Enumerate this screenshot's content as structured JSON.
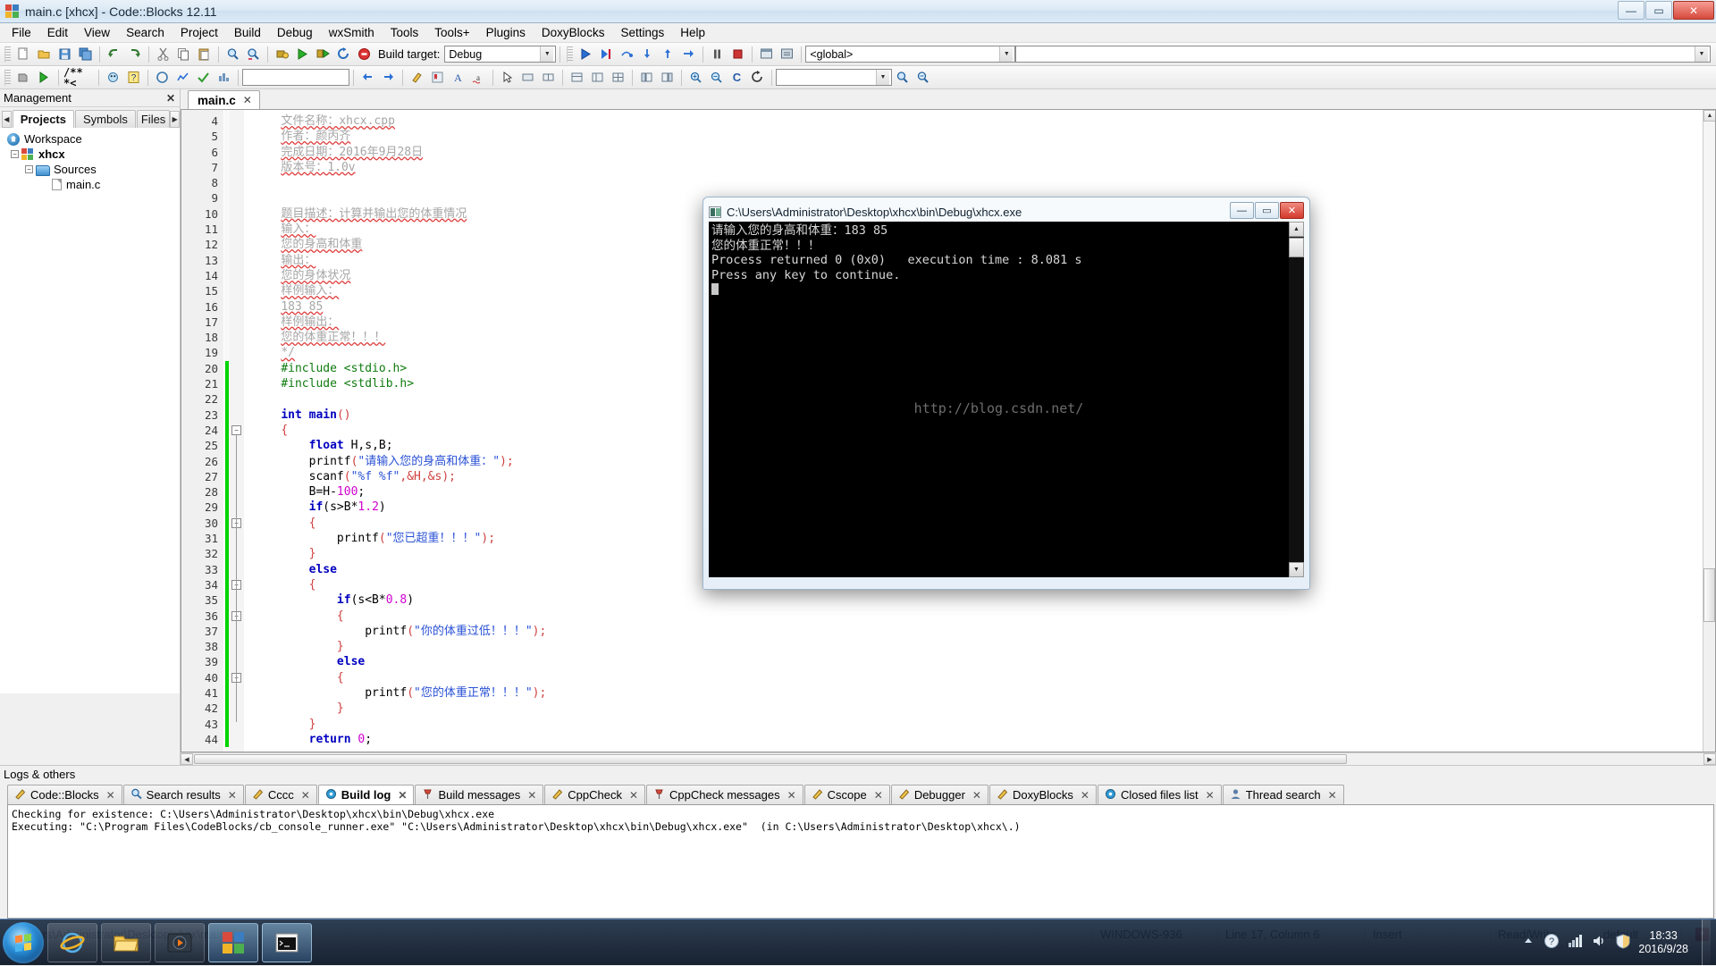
{
  "window": {
    "title": "main.c [xhcx] - Code::Blocks 12.11",
    "buttons": {
      "minimize": "—",
      "maximize": "▭",
      "close": "✕"
    }
  },
  "menubar": {
    "items": [
      "File",
      "Edit",
      "View",
      "Search",
      "Project",
      "Build",
      "Debug",
      "wxSmith",
      "Tools",
      "Tools+",
      "Plugins",
      "DoxyBlocks",
      "Settings",
      "Help"
    ]
  },
  "toolbar": {
    "build_target_label": "Build target:",
    "build_target_value": "Debug",
    "scope_value": "<global>",
    "symbol_value": "",
    "search_value": "",
    "docblock_label": "/** *<"
  },
  "management": {
    "header": "Management",
    "close_label": "✕",
    "tabs": [
      {
        "label": "Projects",
        "active": true
      },
      {
        "label": "Symbols",
        "active": false
      },
      {
        "label": "Files",
        "active": false
      }
    ],
    "tree": {
      "workspace": "Workspace",
      "project": "xhcx",
      "group": "Sources",
      "file": "main.c"
    }
  },
  "editor": {
    "tabs": [
      {
        "label": "main.c",
        "close": "✕",
        "active": true
      }
    ],
    "first_line_number": 4,
    "lines": [
      {
        "n": 4,
        "segments": [
          {
            "t": "    ",
            "c": ""
          },
          {
            "t": "文件名称：xhcx.cpp",
            "c": "cmt"
          }
        ]
      },
      {
        "n": 5,
        "segments": [
          {
            "t": "    ",
            "c": ""
          },
          {
            "t": "作者：颜丙齐",
            "c": "cmt"
          }
        ]
      },
      {
        "n": 6,
        "segments": [
          {
            "t": "    ",
            "c": ""
          },
          {
            "t": "完成日期：2016年9月28日",
            "c": "cmt"
          }
        ]
      },
      {
        "n": 7,
        "segments": [
          {
            "t": "    ",
            "c": ""
          },
          {
            "t": "版本号：1.0v",
            "c": "cmt"
          }
        ]
      },
      {
        "n": 8,
        "segments": []
      },
      {
        "n": 9,
        "segments": []
      },
      {
        "n": 10,
        "segments": [
          {
            "t": "    ",
            "c": ""
          },
          {
            "t": "题目描述：计算并输出您的体重情况",
            "c": "cmt"
          }
        ]
      },
      {
        "n": 11,
        "segments": [
          {
            "t": "    ",
            "c": ""
          },
          {
            "t": "输入：",
            "c": "cmt"
          }
        ]
      },
      {
        "n": 12,
        "segments": [
          {
            "t": "    ",
            "c": ""
          },
          {
            "t": "您的身高和体重",
            "c": "cmt"
          }
        ]
      },
      {
        "n": 13,
        "segments": [
          {
            "t": "    ",
            "c": ""
          },
          {
            "t": "输出：",
            "c": "cmt"
          }
        ]
      },
      {
        "n": 14,
        "segments": [
          {
            "t": "    ",
            "c": ""
          },
          {
            "t": "您的身体状况",
            "c": "cmt"
          }
        ]
      },
      {
        "n": 15,
        "segments": [
          {
            "t": "    ",
            "c": ""
          },
          {
            "t": "样例输入：",
            "c": "cmt"
          }
        ]
      },
      {
        "n": 16,
        "segments": [
          {
            "t": "    ",
            "c": ""
          },
          {
            "t": "183 85",
            "c": "cmt"
          }
        ]
      },
      {
        "n": 17,
        "segments": [
          {
            "t": "    ",
            "c": ""
          },
          {
            "t": "样例输出：",
            "c": "cmt"
          }
        ]
      },
      {
        "n": 18,
        "segments": [
          {
            "t": "    ",
            "c": ""
          },
          {
            "t": "您的体重正常！！！",
            "c": "cmt"
          }
        ]
      },
      {
        "n": 19,
        "segments": [
          {
            "t": "    ",
            "c": ""
          },
          {
            "t": "*/",
            "c": "cmt"
          }
        ]
      },
      {
        "n": 20,
        "segments": [
          {
            "t": "    ",
            "c": ""
          },
          {
            "t": "#include <stdio.h>",
            "c": "pre"
          }
        ]
      },
      {
        "n": 21,
        "segments": [
          {
            "t": "    ",
            "c": ""
          },
          {
            "t": "#include <stdlib.h>",
            "c": "pre"
          }
        ]
      },
      {
        "n": 22,
        "segments": []
      },
      {
        "n": 23,
        "segments": [
          {
            "t": "    ",
            "c": ""
          },
          {
            "t": "int main",
            "c": "kw"
          },
          {
            "t": "()",
            "c": "op"
          }
        ]
      },
      {
        "n": 24,
        "segments": [
          {
            "t": "    ",
            "c": ""
          },
          {
            "t": "{",
            "c": "brace"
          }
        ]
      },
      {
        "n": 25,
        "segments": [
          {
            "t": "        ",
            "c": ""
          },
          {
            "t": "float",
            "c": "kw"
          },
          {
            "t": " H,s,B;",
            "c": ""
          }
        ]
      },
      {
        "n": 26,
        "segments": [
          {
            "t": "        printf",
            "c": ""
          },
          {
            "t": "(",
            "c": "op"
          },
          {
            "t": "\"请输入您的身高和体重：\"",
            "c": "str"
          },
          {
            "t": ");",
            "c": "op"
          }
        ]
      },
      {
        "n": 27,
        "segments": [
          {
            "t": "        scanf",
            "c": ""
          },
          {
            "t": "(",
            "c": "op"
          },
          {
            "t": "\"%f %f\"",
            "c": "str"
          },
          {
            "t": ",&H,&s);",
            "c": "op"
          }
        ]
      },
      {
        "n": 28,
        "segments": [
          {
            "t": "        B=H-",
            "c": ""
          },
          {
            "t": "100",
            "c": "num"
          },
          {
            "t": ";",
            "c": ""
          }
        ]
      },
      {
        "n": 29,
        "segments": [
          {
            "t": "        ",
            "c": ""
          },
          {
            "t": "if",
            "c": "kw"
          },
          {
            "t": "(s>B*",
            "c": ""
          },
          {
            "t": "1.2",
            "c": "num"
          },
          {
            "t": ")",
            "c": ""
          }
        ]
      },
      {
        "n": 30,
        "segments": [
          {
            "t": "        ",
            "c": ""
          },
          {
            "t": "{",
            "c": "brace"
          }
        ]
      },
      {
        "n": 31,
        "segments": [
          {
            "t": "            printf",
            "c": ""
          },
          {
            "t": "(",
            "c": "op"
          },
          {
            "t": "\"您已超重！！！\"",
            "c": "str"
          },
          {
            "t": ");",
            "c": "op"
          }
        ]
      },
      {
        "n": 32,
        "segments": [
          {
            "t": "        ",
            "c": ""
          },
          {
            "t": "}",
            "c": "brace"
          }
        ]
      },
      {
        "n": 33,
        "segments": [
          {
            "t": "        ",
            "c": ""
          },
          {
            "t": "else",
            "c": "kw"
          }
        ]
      },
      {
        "n": 34,
        "segments": [
          {
            "t": "        ",
            "c": ""
          },
          {
            "t": "{",
            "c": "brace"
          }
        ]
      },
      {
        "n": 35,
        "segments": [
          {
            "t": "            ",
            "c": ""
          },
          {
            "t": "if",
            "c": "kw"
          },
          {
            "t": "(s<B*",
            "c": ""
          },
          {
            "t": "0.8",
            "c": "num"
          },
          {
            "t": ")",
            "c": ""
          }
        ]
      },
      {
        "n": 36,
        "segments": [
          {
            "t": "            ",
            "c": ""
          },
          {
            "t": "{",
            "c": "brace"
          }
        ]
      },
      {
        "n": 37,
        "segments": [
          {
            "t": "                printf",
            "c": ""
          },
          {
            "t": "(",
            "c": "op"
          },
          {
            "t": "\"你的体重过低！！！\"",
            "c": "str"
          },
          {
            "t": ");",
            "c": "op"
          }
        ]
      },
      {
        "n": 38,
        "segments": [
          {
            "t": "            ",
            "c": ""
          },
          {
            "t": "}",
            "c": "brace"
          }
        ]
      },
      {
        "n": 39,
        "segments": [
          {
            "t": "            ",
            "c": ""
          },
          {
            "t": "else",
            "c": "kw"
          }
        ]
      },
      {
        "n": 40,
        "segments": [
          {
            "t": "            ",
            "c": ""
          },
          {
            "t": "{",
            "c": "brace"
          }
        ]
      },
      {
        "n": 41,
        "segments": [
          {
            "t": "                printf",
            "c": ""
          },
          {
            "t": "(",
            "c": "op"
          },
          {
            "t": "\"您的体重正常！！！\"",
            "c": "str"
          },
          {
            "t": ");",
            "c": "op"
          }
        ]
      },
      {
        "n": 42,
        "segments": [
          {
            "t": "            ",
            "c": ""
          },
          {
            "t": "}",
            "c": "brace"
          }
        ]
      },
      {
        "n": 43,
        "segments": [
          {
            "t": "        ",
            "c": ""
          },
          {
            "t": "}",
            "c": "brace"
          }
        ]
      },
      {
        "n": 44,
        "segments": [
          {
            "t": "        ",
            "c": ""
          },
          {
            "t": "return",
            "c": "kw"
          },
          {
            "t": " ",
            "c": ""
          },
          {
            "t": "0",
            "c": "num"
          },
          {
            "t": ";",
            "c": ""
          }
        ]
      }
    ]
  },
  "console": {
    "title": "C:\\Users\\Administrator\\Desktop\\xhcx\\bin\\Debug\\xhcx.exe",
    "buttons": {
      "minimize": "—",
      "maximize": "▭",
      "close": "✕"
    },
    "lines": [
      "请输入您的身高和体重：183 85",
      "您的体重正常！！！",
      "Process returned 0 (0x0)   execution time : 8.081 s",
      "Press any key to continue."
    ],
    "watermark": "http://blog.csdn.net/"
  },
  "logs": {
    "header": "Logs & others",
    "tabs": [
      {
        "label": "Code::Blocks",
        "icon": "pencil-icon",
        "active": false
      },
      {
        "label": "Search results",
        "icon": "magnifier-icon",
        "active": false
      },
      {
        "label": "Cccc",
        "icon": "pencil-icon",
        "active": false
      },
      {
        "label": "Build log",
        "icon": "gear-icon",
        "active": true
      },
      {
        "label": "Build messages",
        "icon": "pin-icon",
        "active": false
      },
      {
        "label": "CppCheck",
        "icon": "pencil-icon",
        "active": false
      },
      {
        "label": "CppCheck messages",
        "icon": "pin-icon",
        "active": false
      },
      {
        "label": "Cscope",
        "icon": "pencil-icon",
        "active": false
      },
      {
        "label": "Debugger",
        "icon": "pencil-icon",
        "active": false
      },
      {
        "label": "DoxyBlocks",
        "icon": "pencil-icon",
        "active": false
      },
      {
        "label": "Closed files list",
        "icon": "gear-icon",
        "active": false
      },
      {
        "label": "Thread search",
        "icon": "person-icon",
        "active": false
      }
    ],
    "content": "Checking for existence: C:\\Users\\Administrator\\Desktop\\xhcx\\bin\\Debug\\xhcx.exe\nExecuting: \"C:\\Program Files\\CodeBlocks/cb_console_runner.exe\" \"C:\\Users\\Administrator\\Desktop\\xhcx\\bin\\Debug\\xhcx.exe\"  (in C:\\Users\\Administrator\\Desktop\\xhcx\\.)"
  },
  "statusbar": {
    "path": "C:\\Users\\Administrator\\Desktop\\xhcx\\main.c",
    "encoding": "WINDOWS-936",
    "position": "Line 17, Column 6",
    "mode": "Insert",
    "access": "Read/Write",
    "profile": "default",
    "indicator": "+"
  },
  "taskbar": {
    "start_label": "Start",
    "items": [
      {
        "name": "internet-explorer",
        "label": "Internet Explorer"
      },
      {
        "name": "file-explorer",
        "label": "Windows Explorer"
      },
      {
        "name": "media-player",
        "label": "Media Player"
      },
      {
        "name": "code-blocks",
        "label": "Code::Blocks"
      },
      {
        "name": "console-window",
        "label": "xhcx.exe"
      }
    ],
    "clock_time": "18:33",
    "clock_date": "2016/9/28"
  }
}
